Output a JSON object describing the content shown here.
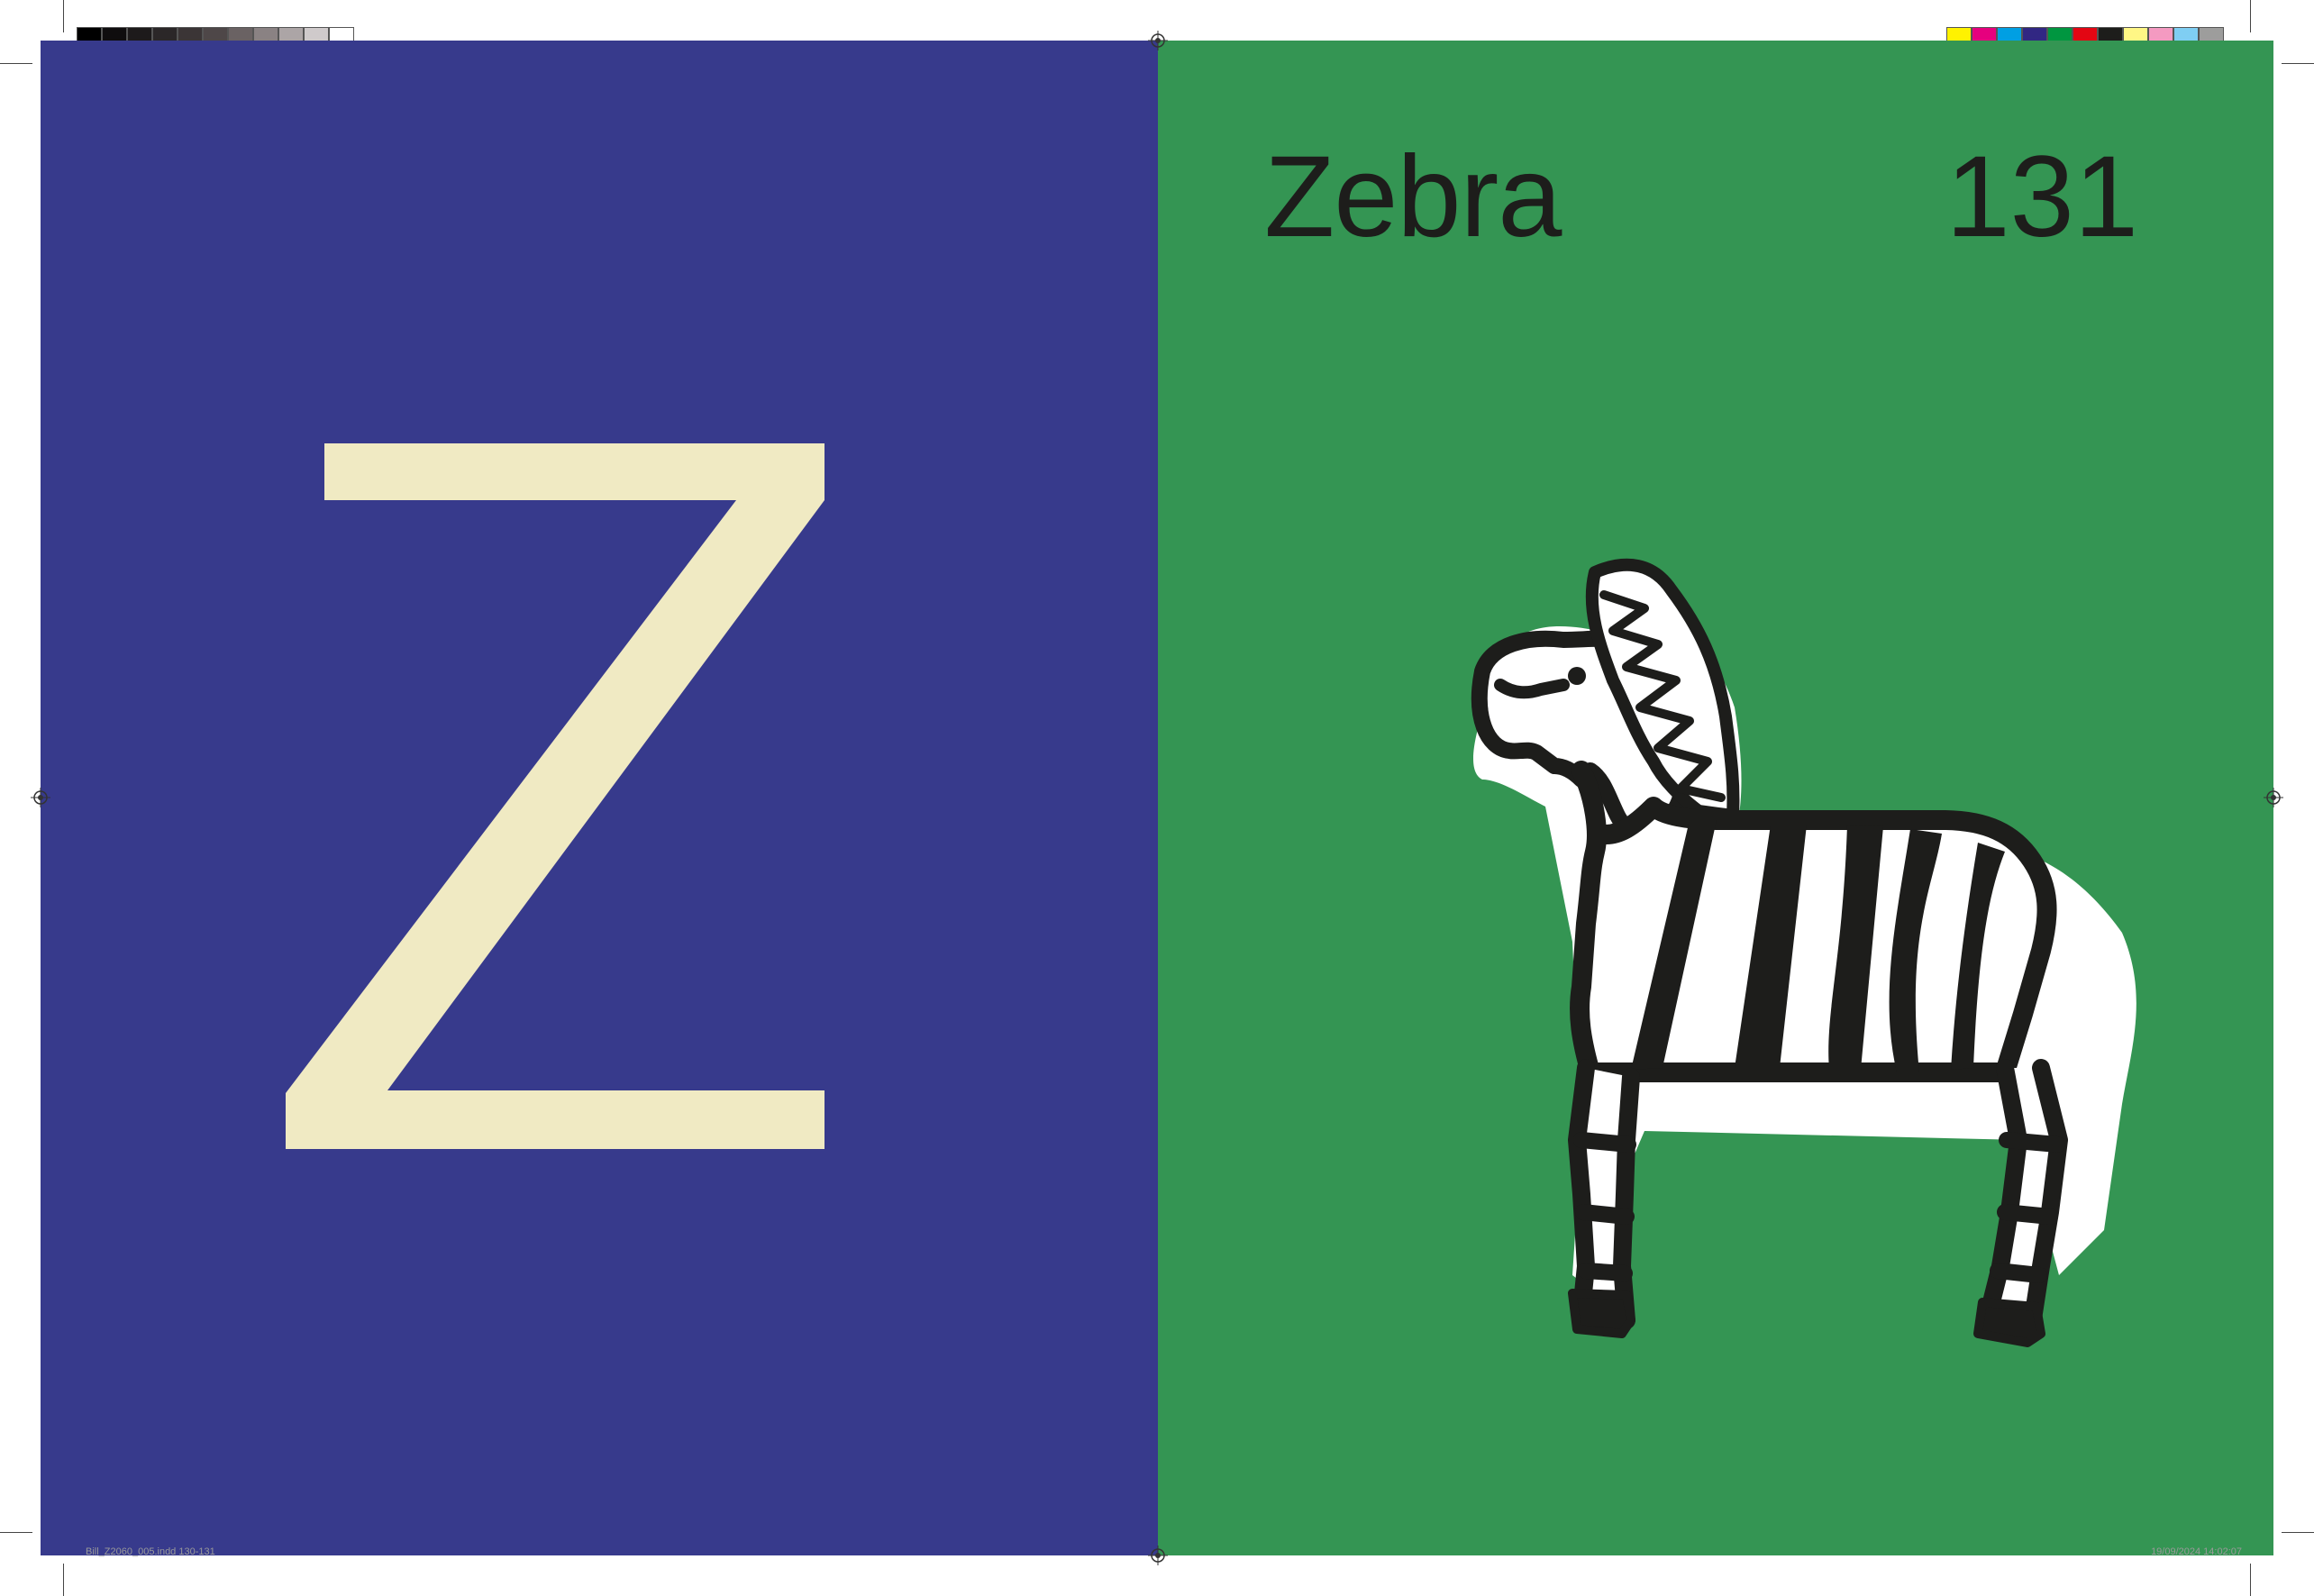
{
  "left_page": {
    "letter": "Z",
    "background": "#373a8c",
    "letter_color": "#f0eac3"
  },
  "right_page": {
    "title": "Zebra",
    "page_number": "131",
    "background": "#349553",
    "text_color": "#1d1d1b",
    "illustration": "zebra-drawing"
  },
  "print_marks": {
    "grayscale_swatches": [
      "#000000",
      "#0f0d0e",
      "#1d1a1b",
      "#2b2728",
      "#3b3536",
      "#4e4748",
      "#6a6263",
      "#8a8283",
      "#aca5a6",
      "#cfcacb",
      "#ffffff"
    ],
    "color_swatches": [
      "#fff200",
      "#e6007e",
      "#009fe3",
      "#312783",
      "#009640",
      "#e30613",
      "#1d1d1b",
      "#fff685",
      "#f49ac1",
      "#7fcef3",
      "#9d9d9c"
    ],
    "slug_left": "Bill_Z2060_005.indd   130-131",
    "slug_right": "19/09/2024   14:02:07"
  }
}
